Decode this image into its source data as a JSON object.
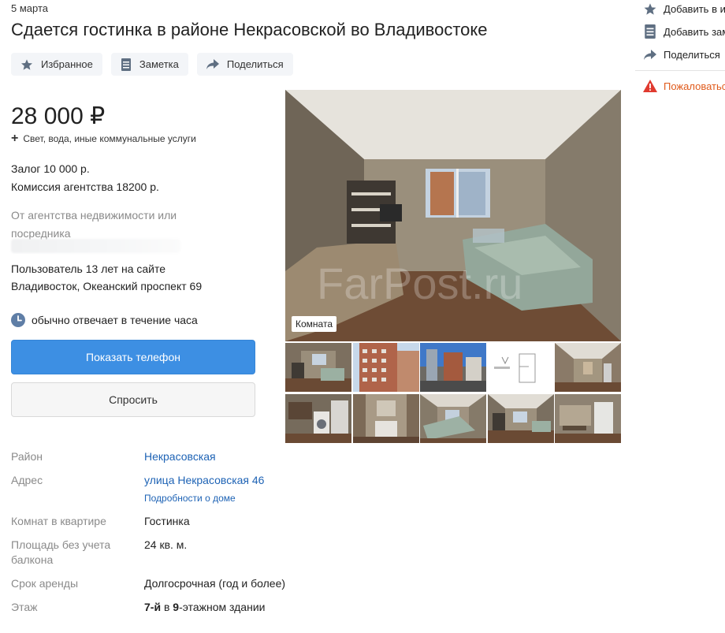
{
  "listing": {
    "date": "5 марта",
    "title": "Сдается гостинка в районе Некрасовской во Владивостоке"
  },
  "actions": {
    "favorite": "Избранное",
    "note": "Заметка",
    "share": "Поделиться"
  },
  "price": {
    "amount": "28 000 ₽",
    "utilities": "Свет, вода, иные коммунальные услуги",
    "deposit": "Залог 10 000 р.",
    "commission": "Комиссия агентства 18200 р."
  },
  "seller": {
    "type": "От агентства недвижимости или посредника",
    "since": "Пользователь 13 лет на сайте",
    "address": "Владивосток, Океанский проспект 69",
    "responds": "обычно отвечает в течение часа"
  },
  "buttons": {
    "show_phone": "Показать телефон",
    "ask": "Спросить"
  },
  "gallery": {
    "main_label": "Комната",
    "watermark": "FarPost.ru",
    "thumbnail_count": 10
  },
  "details": [
    {
      "label": "Район",
      "value": "Некрасовская"
    },
    {
      "label": "Адрес",
      "value": "улица Некрасовская 46",
      "sublink": "Подробности о доме"
    },
    {
      "label": "Комнат в квартире",
      "value": "Гостинка"
    },
    {
      "label": "Площадь без учета балкона",
      "value": "24 кв. м."
    },
    {
      "label": "Срок аренды",
      "value": "Долгосрочная (год и более)"
    },
    {
      "label": "Этаж",
      "value_parts": [
        "7-й",
        " в ",
        "9",
        "-этажном здании"
      ]
    }
  ],
  "sidebar": {
    "add_favorites": "Добавить в и",
    "add_note": "Добавить зам",
    "share": "Поделиться",
    "complain": "Пожаловатьс"
  },
  "colors": {
    "accent_blue": "#3d8fe3",
    "link": "#1e63b5",
    "complain": "#e05a1b",
    "icon_gray": "#5f6f82"
  }
}
